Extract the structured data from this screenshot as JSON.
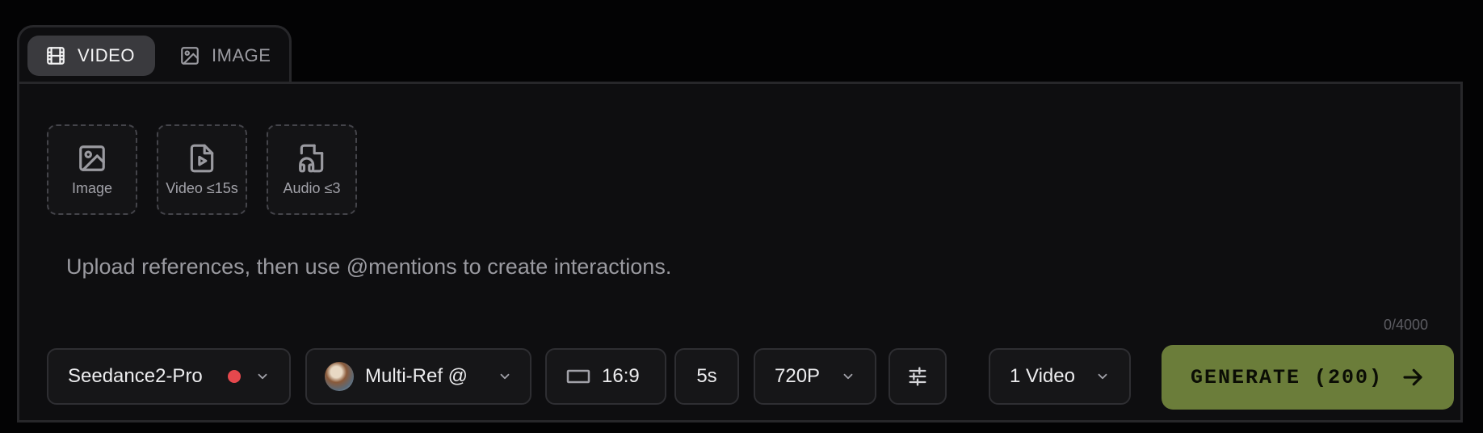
{
  "tabs": [
    {
      "label": "VIDEO",
      "icon": "film-icon",
      "active": true
    },
    {
      "label": "IMAGE",
      "icon": "image-icon",
      "active": false
    }
  ],
  "uploads": [
    {
      "label": "Image",
      "icon": "image-icon"
    },
    {
      "label": "Video ≤15s",
      "icon": "video-file-icon"
    },
    {
      "label": "Audio ≤3",
      "icon": "audio-file-icon"
    }
  ],
  "prompt": {
    "placeholder": "Upload references, then use @mentions to create interactions.",
    "value": "",
    "counter": "0/4000"
  },
  "controls": {
    "model": {
      "label": "Seedance2-Pro",
      "status_color": "#e5484d"
    },
    "reference": {
      "label": "Multi-Ref @"
    },
    "aspect_ratio": {
      "label": "16:9",
      "icon": "aspect-ratio-icon"
    },
    "duration": {
      "label": "5s"
    },
    "resolution": {
      "label": "720P"
    },
    "settings": {
      "icon": "sliders-icon"
    },
    "count": {
      "label": "1 Video"
    }
  },
  "generate": {
    "label": "GENERATE (200)",
    "color": "#6b7d3a"
  }
}
